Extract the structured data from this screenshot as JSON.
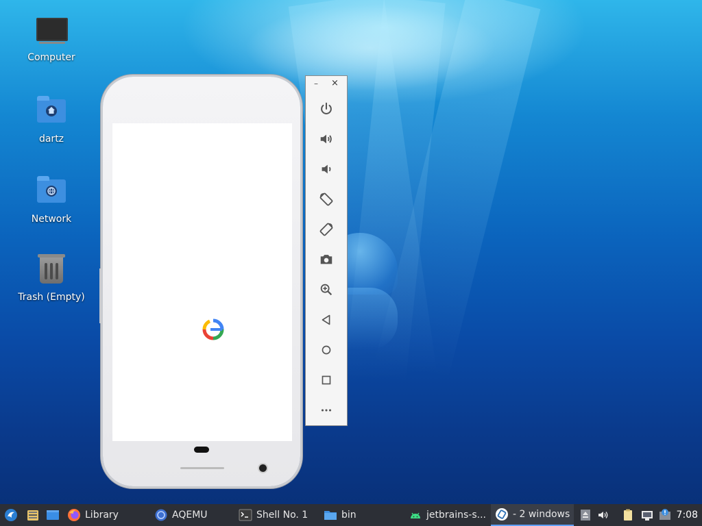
{
  "desktop": {
    "icons": [
      {
        "label": "Computer"
      },
      {
        "label": "dartz"
      },
      {
        "label": "Network"
      },
      {
        "label": "Trash (Empty)"
      }
    ]
  },
  "emulator_panel": {
    "minimize_glyph": "–",
    "close_glyph": "×",
    "buttons": [
      "power-icon",
      "volume-up-icon",
      "volume-down-icon",
      "rotate-left-icon",
      "rotate-right-icon",
      "camera-icon",
      "zoom-in-icon",
      "back-icon",
      "home-icon",
      "overview-icon",
      "more-icon"
    ]
  },
  "taskbar": {
    "items": [
      {
        "label": "Library"
      },
      {
        "label": "AQEMU"
      },
      {
        "label": "Shell No. 1"
      },
      {
        "label": "bin"
      },
      {
        "label": "jetbrains-s..."
      },
      {
        "label": "- 2 windows"
      }
    ],
    "clock": "7:08"
  },
  "colors": {
    "taskbar_bg": "#2c2f36",
    "accent": "#5fa0ff",
    "google_blue": "#4285F4",
    "google_red": "#EA4335",
    "google_yellow": "#FBBC05",
    "google_green": "#34A853"
  }
}
